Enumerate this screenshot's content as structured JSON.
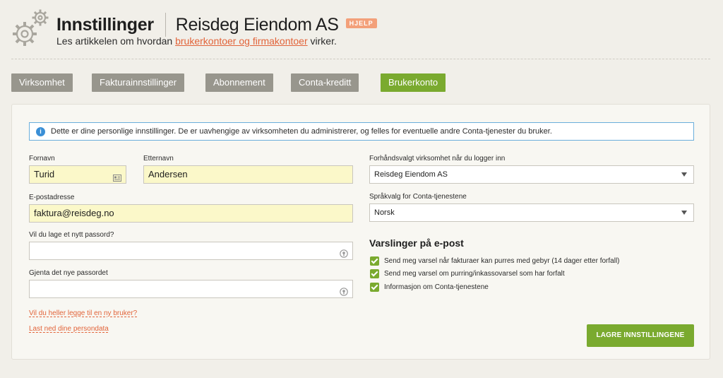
{
  "header": {
    "title": "Innstillinger",
    "company": "Reisdeg Eiendom AS",
    "help_badge": "HJELP",
    "subtitle_prefix": "Les artikkelen om hvordan ",
    "subtitle_link": "brukerkontoer og firmakontoer",
    "subtitle_suffix": " virker."
  },
  "tabs": [
    {
      "label": "Virksomhet"
    },
    {
      "label": "Fakturainnstillinger"
    },
    {
      "label": "Abonnement"
    },
    {
      "label": "Conta-kreditt"
    },
    {
      "label": "Brukerkonto",
      "active": true
    }
  ],
  "info_text": "Dette er dine personlige innstillinger. De er uavhengige av virksomheten du administrerer, og felles for eventuelle andre Conta-tjenester du bruker.",
  "form": {
    "first_name": {
      "label": "Fornavn",
      "value": "Turid"
    },
    "last_name": {
      "label": "Etternavn",
      "value": "Andersen"
    },
    "email": {
      "label": "E-postadresse",
      "value": "faktura@reisdeg.no"
    },
    "new_password": {
      "label": "Vil du lage et nytt passord?",
      "value": ""
    },
    "repeat_password": {
      "label": "Gjenta det nye passordet",
      "value": ""
    },
    "default_company": {
      "label": "Forhåndsvalgt virksomhet når du logger inn",
      "value": "Reisdeg Eiendom AS"
    },
    "language": {
      "label": "Språkvalg for Conta-tjenestene",
      "value": "Norsk"
    }
  },
  "notifications": {
    "title": "Varslinger på e-post",
    "items": [
      {
        "label": "Send meg varsel når fakturaer kan purres med gebyr (14 dager etter forfall)",
        "checked": true
      },
      {
        "label": "Send meg varsel om purring/inkassovarsel som har forfalt",
        "checked": true
      },
      {
        "label": "Informasjon om Conta-tjenestene",
        "checked": true
      }
    ]
  },
  "links": {
    "add_user": "Vil du heller legge til en ny bruker?",
    "download_data": "Last ned dine persondata"
  },
  "save_label": "LAGRE INNSTILLINGENE",
  "colors": {
    "accent": "#7aaa2f",
    "link": "#e2643a",
    "tab_inactive": "#98968d",
    "info_border": "#6aaedb"
  }
}
